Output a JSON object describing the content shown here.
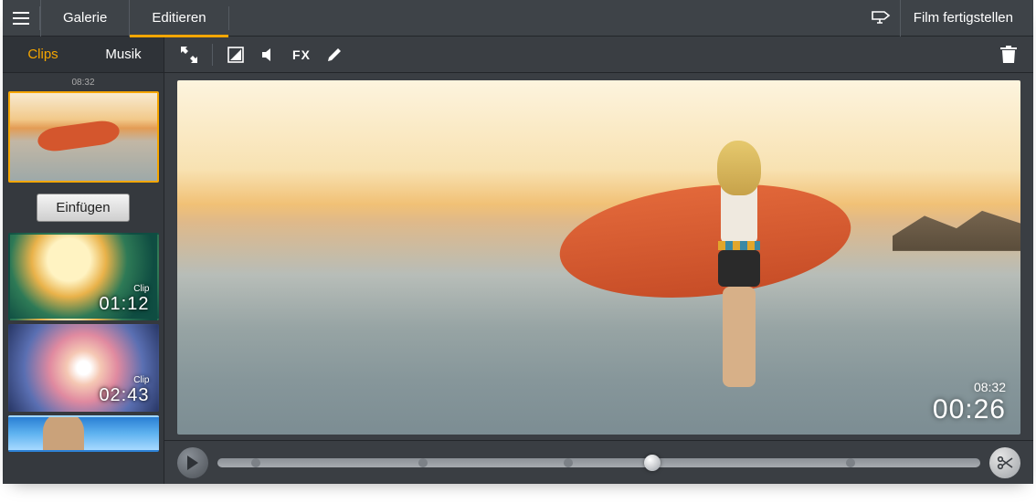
{
  "topnav": {
    "tabs": {
      "gallery": "Galerie",
      "edit": "Editieren",
      "active": "edit"
    },
    "finish_label": "Film fertigstellen"
  },
  "sidebar": {
    "tabs": {
      "clips": "Clips",
      "music": "Musik",
      "active": "clips"
    },
    "selected_clip_time": "08:32",
    "insert_label": "Einfügen",
    "clips": [
      {
        "type_label": "Clip",
        "duration": "01:12"
      },
      {
        "type_label": "Clip",
        "duration": "02:43"
      }
    ]
  },
  "toolbar": {
    "icons": {
      "fullscreen": "fullscreen-icon",
      "crop": "crop-icon",
      "volume": "volume-icon",
      "fx": "FX",
      "draw": "pencil-icon",
      "delete": "trash-icon"
    }
  },
  "preview": {
    "total_time": "08:32",
    "current_time": "00:26"
  },
  "timeline": {
    "playhead_pct": 57,
    "marks_pct": [
      5,
      27,
      46,
      83
    ]
  },
  "colors": {
    "accent": "#f6a600",
    "panel": "#3a3e43"
  }
}
